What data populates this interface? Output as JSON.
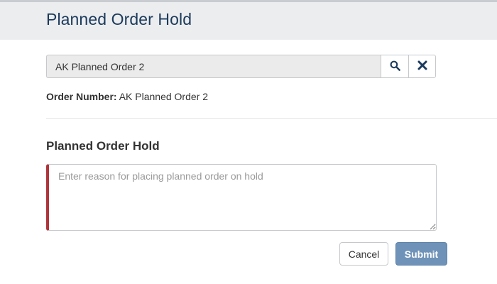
{
  "header": {
    "title": "Planned Order Hold"
  },
  "search": {
    "value": "AK Planned Order 2",
    "search_icon": "search-icon",
    "clear_icon": "close-icon"
  },
  "order": {
    "label": "Order Number:",
    "value": "AK Planned Order 2"
  },
  "hold_form": {
    "title": "Planned Order Hold",
    "reason_placeholder": "Enter reason for placing planned order on hold",
    "reason_value": ""
  },
  "actions": {
    "cancel_label": "Cancel",
    "submit_label": "Submit"
  },
  "colors": {
    "title": "#1b3a5c",
    "required_marker": "#b0343b",
    "submit_bg": "#6f93b8",
    "header_bg": "#ecedef"
  }
}
